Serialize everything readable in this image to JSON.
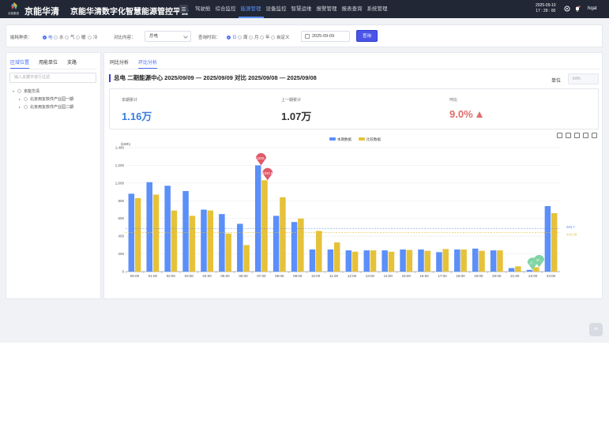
{
  "header": {
    "logo_text": "京能集团",
    "brand": "京能华清",
    "platform_title": "京能华清数字化智慧能源管控平台",
    "nav": [
      "驾驶舱",
      "综合监控",
      "能源管理",
      "设备监控",
      "智慧运维",
      "报警管理",
      "报表查询",
      "系统管理"
    ],
    "active_nav": 2,
    "date": "2025-09-10",
    "time": "17 : 29 : 00",
    "user": "hqat"
  },
  "filters": {
    "energy_type_label": "能耗种类：",
    "energy_types": [
      "电",
      "水",
      "气",
      "暖",
      "冷"
    ],
    "energy_type_selected": 0,
    "compare_label": "对比内容：",
    "compare_value": "总电",
    "time_label": "查询时间：",
    "time_options": [
      "日",
      "周",
      "月",
      "年",
      "自定义"
    ],
    "time_selected": 0,
    "date_value": "2025-09-09",
    "query_button": "查询"
  },
  "left_panel": {
    "tabs": [
      "区域位置",
      "用能单位",
      "支路"
    ],
    "active_tab": 0,
    "search_placeholder": "输入关键字进行过滤",
    "tree": [
      {
        "label": "京能华清",
        "level": 0,
        "expand": "▾"
      },
      {
        "label": "北京用友软件产业园一期",
        "level": 1,
        "expand": "▸"
      },
      {
        "label": "北京用友软件产业园二期",
        "level": 1,
        "expand": "▸"
      }
    ]
  },
  "right_panel": {
    "tabs": [
      "同比分析",
      "环比分析"
    ],
    "active_tab": 1,
    "heading": "总电 二期能源中心 2025/09/09 — 2025/09/09 对比 2025/09/08 — 2025/09/08",
    "unit_label": "单位",
    "unit_placeholder": "kWh",
    "kpis": [
      {
        "label": "本期累计",
        "value": "1.16万",
        "color": "#3b7ddd"
      },
      {
        "label": "上一期累计",
        "value": "1.07万",
        "color": "#333333"
      },
      {
        "label": "环比",
        "value": "9.0%",
        "color": "#e06c6c",
        "trend": "up"
      }
    ]
  },
  "chart_data": {
    "type": "bar",
    "ylabel": "(kWh)",
    "ylim": [
      0,
      1400
    ],
    "yticks": [
      0,
      200,
      400,
      600,
      800,
      1000,
      1200,
      1400
    ],
    "categories": [
      "00:00",
      "01:00",
      "02:00",
      "03:00",
      "04:00",
      "05:00",
      "06:00",
      "07:00",
      "08:00",
      "09:00",
      "10:00",
      "11:00",
      "12:00",
      "13:00",
      "14:00",
      "15:00",
      "16:00",
      "17:00",
      "18:00",
      "19:00",
      "20:00",
      "21:00",
      "22:00",
      "23:00"
    ],
    "series": [
      {
        "name": "本期数据",
        "color": "#5b8ff9",
        "values": [
          880,
          1010,
          970,
          910,
          700,
          650,
          540,
          1200,
          630,
          560,
          250,
          250,
          240,
          240,
          240,
          250,
          250,
          220,
          250,
          260,
          240,
          40,
          20,
          740
        ]
      },
      {
        "name": "比较数据",
        "color": "#e6c23a",
        "values": [
          830,
          870,
          690,
          630,
          690,
          430,
          300,
          1032,
          840,
          600,
          460,
          330,
          225,
          240,
          225,
          245,
          235,
          255,
          250,
          235,
          240,
          60,
          50,
          660
        ]
      }
    ],
    "max_markers": [
      {
        "series": 0,
        "index": 7,
        "label": "1200.."
      },
      {
        "series": 1,
        "index": 7,
        "label": "1032.6"
      }
    ],
    "min_markers": [
      {
        "series": 0,
        "index": 22,
        "label": "17..."
      },
      {
        "series": 1,
        "index": 22,
        "label": "47..."
      }
    ],
    "average_lines": [
      {
        "series": 0,
        "value": 483.7,
        "label": "483.7"
      },
      {
        "series": 1,
        "value": 443.09,
        "label": "443.09"
      }
    ],
    "legend_position": "top-center"
  }
}
